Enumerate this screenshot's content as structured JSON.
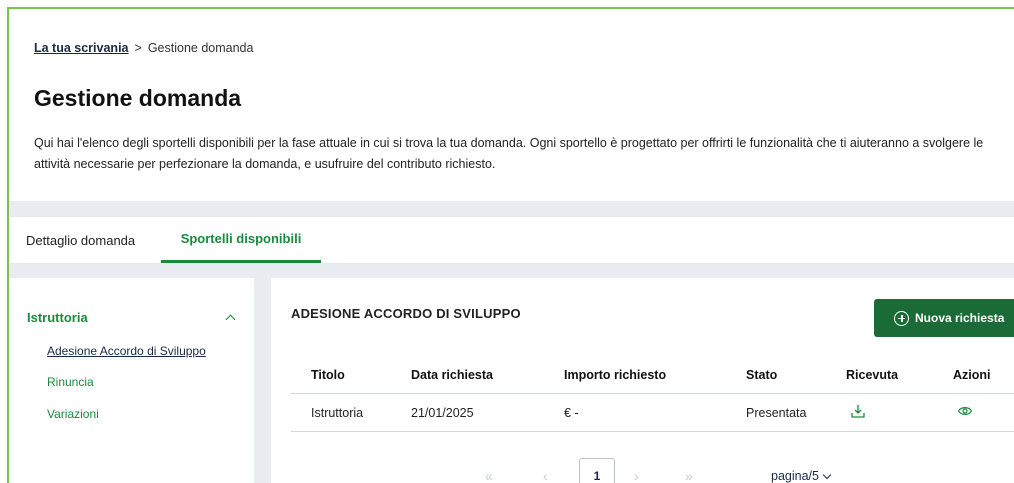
{
  "breadcrumb": {
    "home": "La tua scrivania",
    "separator": ">",
    "current": "Gestione domanda"
  },
  "page": {
    "title": "Gestione domanda",
    "intro": "Qui hai l'elenco degli sportelli disponibili per la fase attuale in cui si trova la tua domanda. Ogni sportello è progettato per offrirti le funzionalità che ti aiuteranno a svolgere le attività necessarie per perfezionare la domanda, e usufruire del contributo richiesto."
  },
  "tabs": [
    {
      "label": "Dettaglio domanda",
      "active": false
    },
    {
      "label": "Sportelli disponibili",
      "active": true
    }
  ],
  "sidebar": {
    "section": "Istruttoria",
    "items": [
      {
        "label": "Adesione Accordo di Sviluppo",
        "active": true
      },
      {
        "label": "Rinuncia",
        "active": false
      },
      {
        "label": "Variazioni",
        "active": false
      }
    ]
  },
  "main": {
    "section_title": "ADESIONE ACCORDO DI SVILUPPO",
    "new_button_label": "Nuova richiesta",
    "new_button_icon": "plus-circle-icon",
    "table": {
      "headers": [
        "Titolo",
        "Data richiesta",
        "Importo richiesto",
        "Stato",
        "Ricevuta",
        "Azioni"
      ],
      "rows": [
        {
          "titolo": "Istruttoria",
          "data": "21/01/2025",
          "importo": "€ -",
          "stato": "Presentata",
          "ricevuta_icon": "download-icon",
          "azioni_icon": "eye-icon"
        }
      ]
    },
    "pagination": {
      "first": "«",
      "prev": "‹",
      "current_page": "1",
      "next": "›",
      "last": "»",
      "page_size_label": "pagina/5"
    }
  },
  "colors": {
    "accent": "#1a8a3e",
    "button": "#1a6b35",
    "band": "#e9edf1",
    "frame": "#7cc24a"
  }
}
